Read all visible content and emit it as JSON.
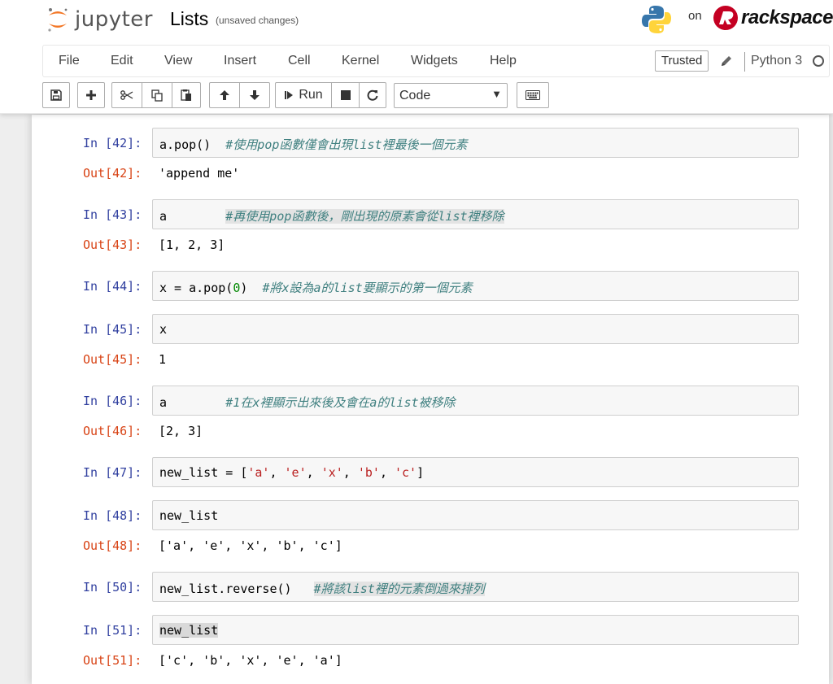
{
  "header": {
    "logo_text": "jupyter",
    "notebook_name": "Lists",
    "save_status": "(unsaved changes)",
    "on_text": "on",
    "host_brand": "rackspace"
  },
  "menu": {
    "items": [
      "File",
      "Edit",
      "View",
      "Insert",
      "Cell",
      "Kernel",
      "Widgets",
      "Help"
    ],
    "trusted_label": "Trusted",
    "kernel_name": "Python 3"
  },
  "toolbar": {
    "run_label": "Run",
    "cell_type": "Code",
    "icons": [
      "save-icon",
      "plus-icon",
      "cut-icon",
      "copy-icon",
      "paste-icon",
      "arrow-up-icon",
      "arrow-down-icon",
      "run-icon",
      "stop-icon",
      "restart-icon",
      "keyboard-icon"
    ]
  },
  "cells": [
    {
      "in": "In [42]:",
      "code": "a.pop()",
      "comment": "#使用pop函數僅會出現list裡最後一個元素",
      "out": "Out[42]:",
      "output": "'append me'"
    },
    {
      "in": "In [43]:",
      "code": "a",
      "comment": "#再使用pop函數後，剛出現的原素會從list裡移除",
      "out": "Out[43]:",
      "output": "[1, 2, 3]"
    },
    {
      "in": "In [44]:",
      "code_a": "x = a.pop(",
      "code_num": "0",
      "code_b": ")",
      "comment": "#將x設為a的list要顯示的第一個元素"
    },
    {
      "in": "In [45]:",
      "code": "x",
      "out": "Out[45]:",
      "output": "1"
    },
    {
      "in": "In [46]:",
      "code": "a",
      "comment": "#1在x裡顯示出來後及會在a的list被移除",
      "out": "Out[46]:",
      "output": "[2, 3]"
    },
    {
      "in": "In [47]:",
      "code_prefix": "new_list = [",
      "strings": [
        "'a'",
        "'e'",
        "'x'",
        "'b'",
        "'c'"
      ],
      "code_suffix": "]"
    },
    {
      "in": "In [48]:",
      "code": "new_list",
      "out": "Out[48]:",
      "output": "['a', 'e', 'x', 'b', 'c']"
    },
    {
      "in": "In [50]:",
      "code": "new_list.reverse()",
      "comment": "#將該list裡的元素倒過來排列"
    },
    {
      "in": "In [51]:",
      "code": "new_list",
      "out": "Out[51]:",
      "output": "['c', 'b', 'x', 'e', 'a']"
    }
  ],
  "colors": {
    "in_prompt": "#303F9F",
    "out_prompt": "#D84315",
    "comment": "#408080",
    "string": "#BA2121",
    "number": "#008800"
  }
}
